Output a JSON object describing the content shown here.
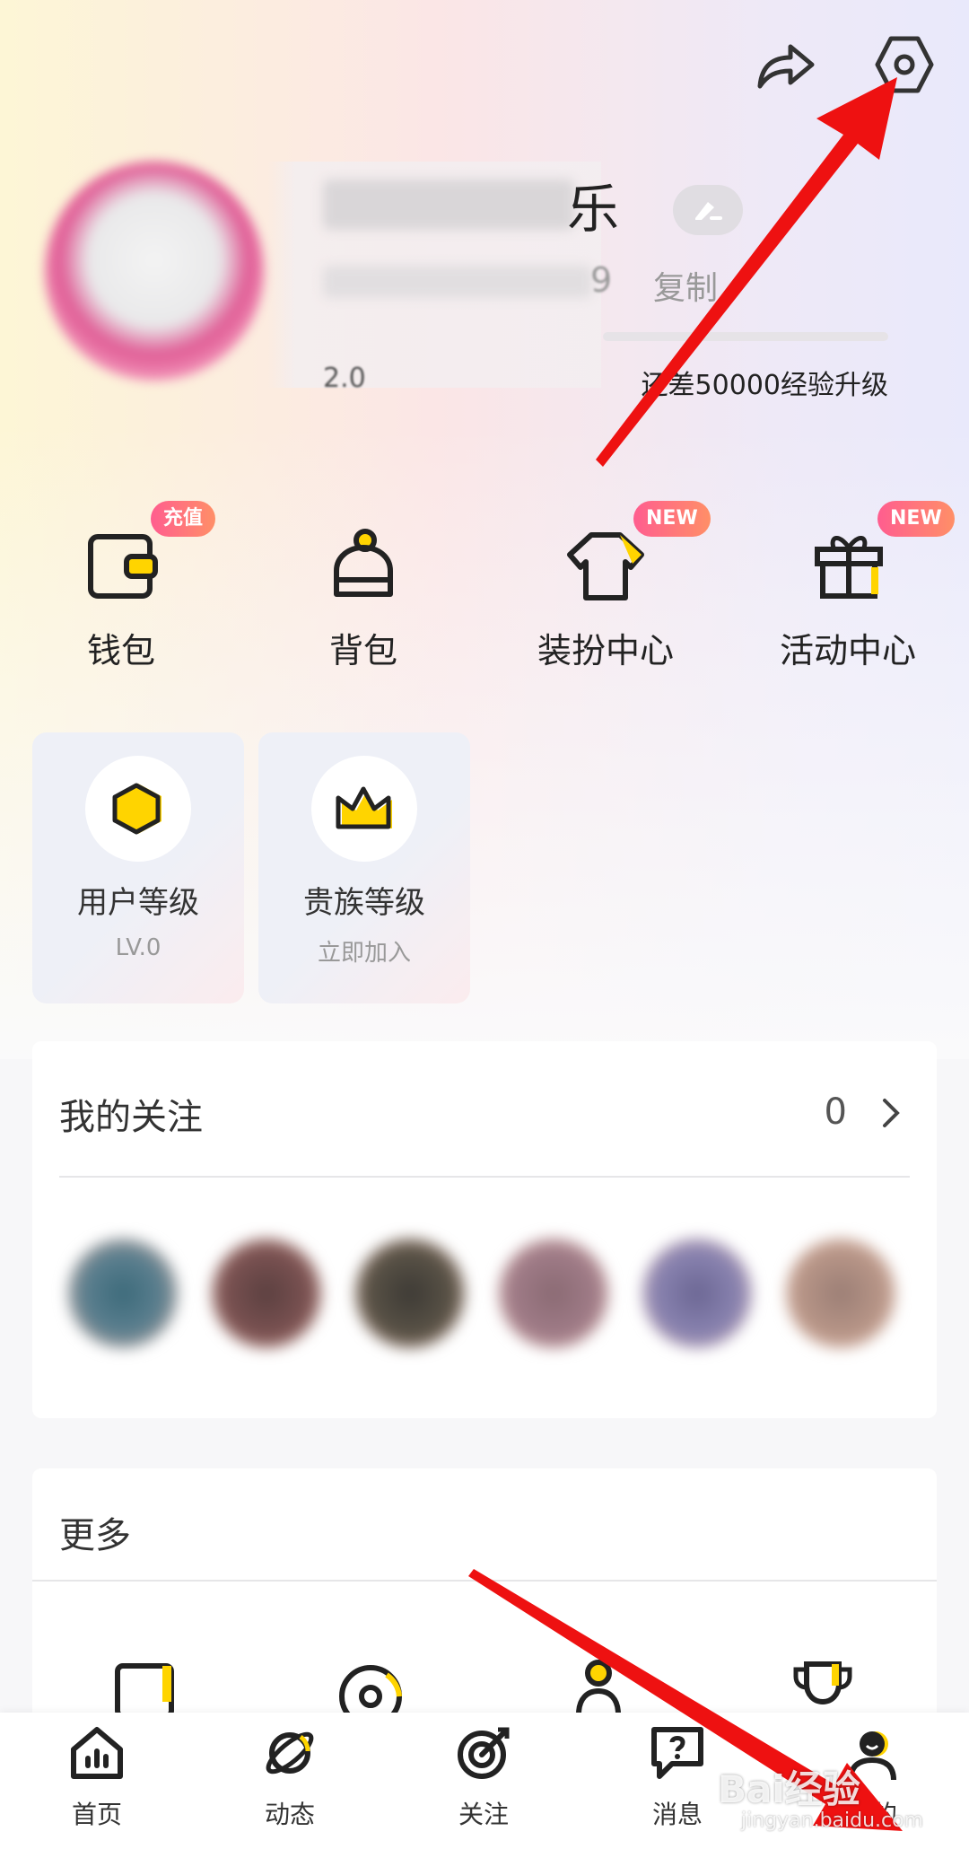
{
  "header": {
    "share_icon": "share-icon",
    "settings_icon": "settings-hexagon-icon"
  },
  "profile": {
    "name_visible": "乐",
    "id_visible": "9",
    "copy_label": "复制",
    "level_visible": "2.0",
    "xp_hint": "还差50000经验升级"
  },
  "quick_menu": [
    {
      "label": "钱包",
      "icon": "wallet-icon",
      "badge": "充值"
    },
    {
      "label": "背包",
      "icon": "backpack-icon",
      "badge": ""
    },
    {
      "label": "装扮中心",
      "icon": "tshirt-icon",
      "badge": "NEW"
    },
    {
      "label": "活动中心",
      "icon": "gift-icon",
      "badge": "NEW"
    }
  ],
  "level_cards": [
    {
      "title": "用户等级",
      "subtitle": "LV.0",
      "icon": "hexagon-icon"
    },
    {
      "title": "贵族等级",
      "subtitle": "立即加入",
      "icon": "crown-icon"
    }
  ],
  "follow": {
    "title": "我的关注",
    "count": "0"
  },
  "more": {
    "title": "更多"
  },
  "bottom_nav": [
    {
      "label": "首页",
      "icon": "home-chart-icon"
    },
    {
      "label": "动态",
      "icon": "planet-icon"
    },
    {
      "label": "关注",
      "icon": "target-icon"
    },
    {
      "label": "消息",
      "icon": "message-icon"
    },
    {
      "label": "我的",
      "icon": "profile-icon"
    }
  ],
  "watermark": {
    "text": "Bai经验",
    "url_text": "jingyan.baidu.com"
  },
  "colors": {
    "accent_yellow": "#ffd400",
    "badge_gradient_start": "#ff5d8f",
    "badge_gradient_end": "#ff8f67",
    "annotation_red": "#ee1111"
  }
}
